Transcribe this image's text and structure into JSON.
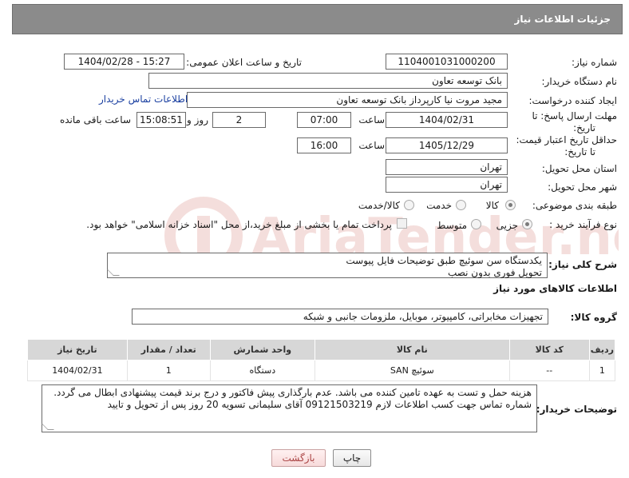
{
  "header": {
    "title": "جزئیات اطلاعات نیاز"
  },
  "form": {
    "need_number": {
      "label": "شماره نیاز:",
      "value": "1104001031000200"
    },
    "announce_datetime": {
      "label": "تاریخ و ساعت اعلان عمومی:",
      "value": "1404/02/28 - 15:27"
    },
    "buyer_org": {
      "label": "نام دستگاه خریدار:",
      "value": "بانک توسعه تعاون"
    },
    "requester": {
      "label": "ایجاد کننده درخواست:",
      "value": "مجید مروت نیا کارپرداز بانک توسعه تعاون",
      "contact_link": "اطلاعات تماس خریدار"
    },
    "deadline": {
      "label_line1": "مهلت ارسال پاسخ: تا",
      "label_line2": "تاریخ:",
      "date": "1404/02/31",
      "time_label": "ساعت",
      "time": "07:00",
      "days": "2",
      "days_label": "روز و",
      "remaining": "15:08:51",
      "remaining_label": "ساعت باقی مانده"
    },
    "price_validity": {
      "label_line1": "حداقل تاریخ اعتبار قیمت:",
      "label_line2": "تا تاریخ:",
      "date": "1405/12/29",
      "time_label": "ساعت",
      "time": "16:00"
    },
    "province": {
      "label": "استان محل تحویل:",
      "value": "تهران"
    },
    "city": {
      "label": "شهر محل تحویل:",
      "value": "تهران"
    },
    "category": {
      "label": "طبقه بندی موضوعی:",
      "options": [
        "کالا",
        "خدمت",
        "کالا/خدمت"
      ],
      "selected": "کالا"
    },
    "purchase_type": {
      "label": "نوع فرآیند خرید :",
      "options": [
        "جزیی",
        "متوسط"
      ],
      "selected": "جزیی",
      "payment_note": "پرداخت تمام یا بخشی از مبلغ خرید،از محل \"اسناد خزانه اسلامی\" خواهد بود."
    },
    "description": {
      "label": "شرح کلی نیاز:",
      "line1": "یکدستگاه سن سوئیچ طبق توضیحات فایل پیوست",
      "line2": "تحویل فوری بدون نصب"
    }
  },
  "goods": {
    "section_title": "اطلاعات کالاهای مورد نیاز",
    "group_label": "گروه کالا:",
    "group_value": "تجهیزات مخابراتی، کامپیوتر، موبایل، ملزومات جانبی و شبکه",
    "columns": [
      "ردیف",
      "کد کالا",
      "نام کالا",
      "واحد شمارش",
      "تعداد / مقدار",
      "تاریخ نیاز"
    ],
    "rows": [
      {
        "row": "1",
        "code": "--",
        "name": "سوئیچ SAN",
        "unit": "دستگاه",
        "qty": "1",
        "date": "1404/02/31"
      }
    ]
  },
  "buyer_notes": {
    "label": "توضیحات خریدار:",
    "line1": "هزینه حمل و تست به عهده تامین کننده می باشد. عدم بارگذاری پیش فاکتور و درج برند قیمت پیشنهادی ابطال می گردد.",
    "line2": "شماره تماس جهت کسب اطلاعات لازم 09121503219 آقای سلیمانی تسویه 20 روز پس از تحویل و تایید"
  },
  "buttons": {
    "print": "چاپ",
    "back": "بازگشت"
  },
  "watermark": {
    "text": "AriaTender.neT"
  },
  "colors": {
    "header_bg": "#8b8b8b",
    "link": "#1a3fa0",
    "table_header": "#d7d7d7",
    "watermark": "#c0392b"
  }
}
